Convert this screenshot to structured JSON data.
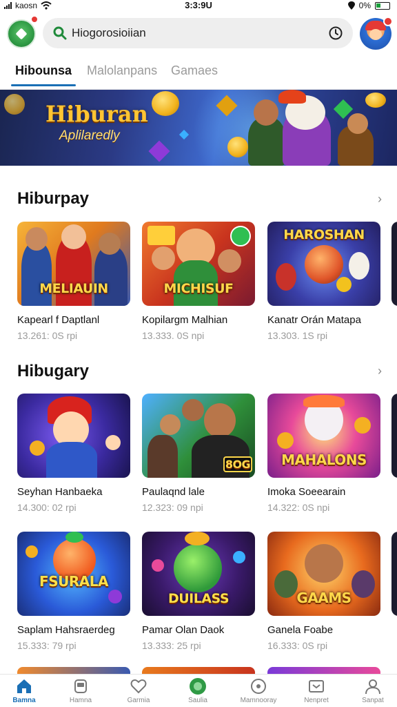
{
  "status_bar": {
    "carrier": "kaosn",
    "time": "3:3:9U",
    "battery": "0%"
  },
  "search": {
    "value": "Hiogorosioiian"
  },
  "tabs": [
    {
      "label": "Hibounsa",
      "active": true
    },
    {
      "label": "Malolanpans",
      "active": false
    },
    {
      "label": "Gamaes",
      "active": false
    }
  ],
  "banner": {
    "title": "Hiburan",
    "subtitle": "Aplilaredly"
  },
  "sections": [
    {
      "title": "Hiburpay",
      "more": "›",
      "cards": [
        {
          "title": "Kapearl f Daptlanl",
          "meta": "13.261: 0S  rpi",
          "art": "MELIAUIN"
        },
        {
          "title": "Kopilargm Malhian",
          "meta": "13.333. 0S  npi",
          "art": "MICHISUF"
        },
        {
          "title": "Kanatr Orán Matapa",
          "meta": "13.303. 1S  rpi",
          "art": "HAROSHAN"
        }
      ]
    },
    {
      "title": "Hibugary",
      "more": "›",
      "cards": [
        {
          "title": "Seyhan Hanbaeka",
          "meta": "14.300: 02  rpi",
          "art": ""
        },
        {
          "title": "Paulaqnd lale",
          "meta": "12.323: 09  npi",
          "art": "8OG"
        },
        {
          "title": "Imoka Soeearain",
          "meta": "14.322: 0S  npi",
          "art": "MAHALONS"
        }
      ]
    },
    {
      "title": "",
      "more": "",
      "cards": [
        {
          "title": "Saplam Hahsraerdeg",
          "meta": "15.333: 79  rpi",
          "art": "FSURALA"
        },
        {
          "title": "Pamar Olan Daok",
          "meta": "13.333: 25  rpi",
          "art": "DUILASS"
        },
        {
          "title": "Ganela Foabe",
          "meta": "16.333: 0S  rpi",
          "art": "GAAMS"
        }
      ]
    }
  ],
  "bottom_nav": [
    {
      "label": "Bamna",
      "icon": "home-icon",
      "active": true
    },
    {
      "label": "Hamna",
      "icon": "gamepad-icon",
      "active": false
    },
    {
      "label": "Garmia",
      "icon": "heart-icon",
      "active": false
    },
    {
      "label": "Saulia",
      "icon": "globe-icon",
      "active": false
    },
    {
      "label": "Mamnooray",
      "icon": "disc-icon",
      "active": false
    },
    {
      "label": "Nenpret",
      "icon": "inbox-icon",
      "active": false
    },
    {
      "label": "Sanpat",
      "icon": "profile-icon",
      "active": false
    }
  ],
  "colors": {
    "accent": "#1a6fb5",
    "brand_green": "#2f9a45",
    "banner_gold": "#ffc533"
  }
}
